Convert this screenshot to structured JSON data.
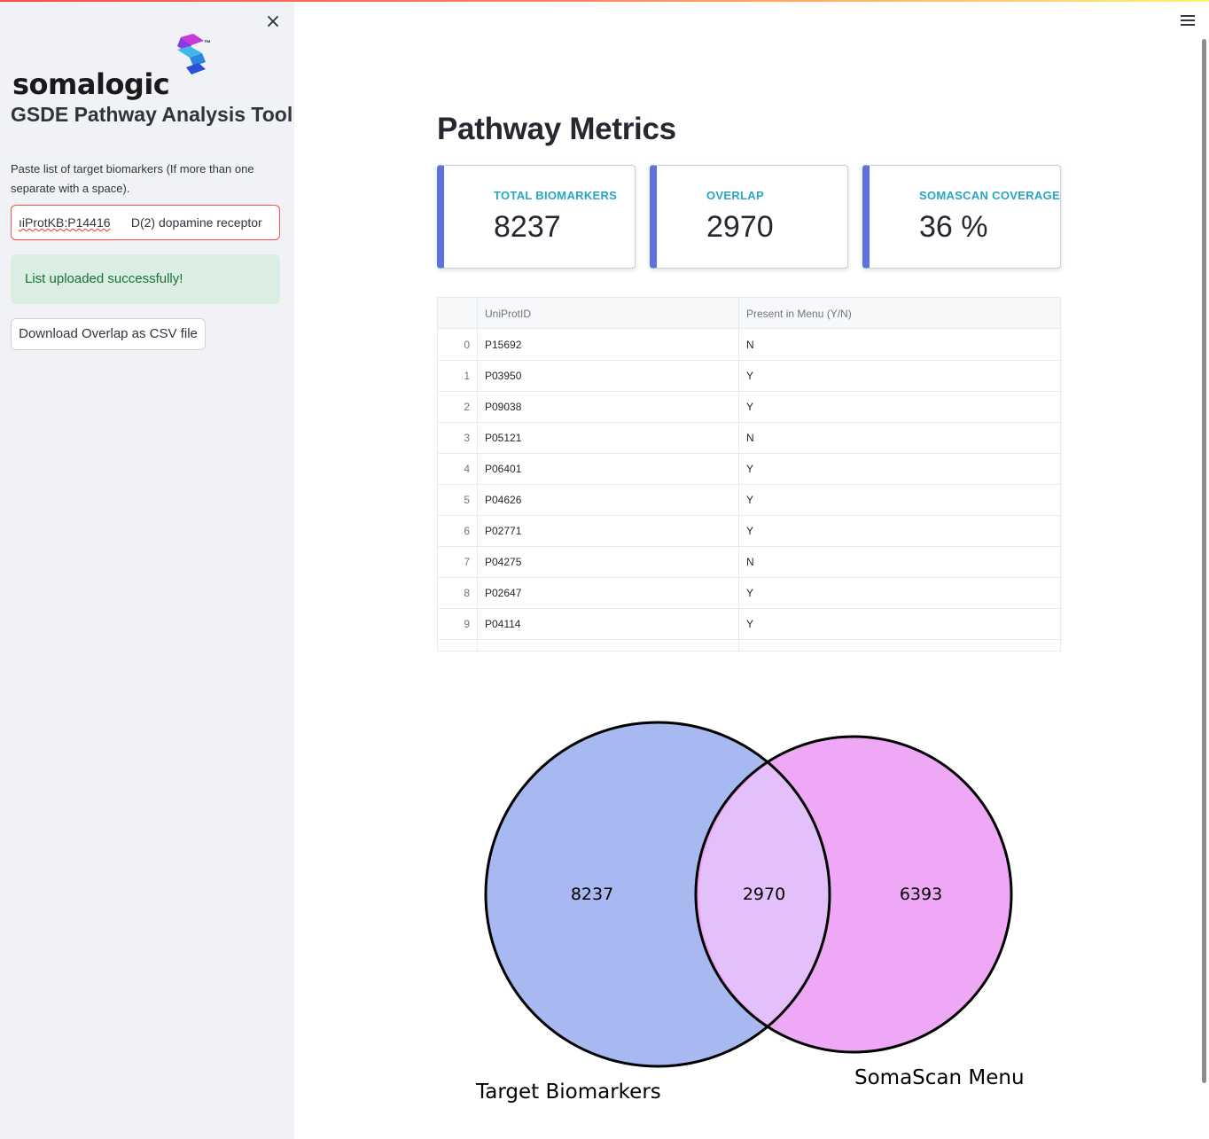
{
  "sidebar": {
    "close_label": "×",
    "logo_text": "somalogic",
    "logo_tm": "™",
    "app_title": "GSDE Pathway Analysis Tool",
    "paste_label": "Paste list of target biomarkers (If more than one separate with a space).",
    "input_value_prefix": "ıiProtKB:P14416",
    "input_value_suffix": "      D(2) dopamine receptor",
    "success_message": "List uploaded successfully!",
    "download_label": "Download Overlap as CSV file"
  },
  "main": {
    "title": "Pathway Metrics",
    "metrics": [
      {
        "label": "TOTAL BIOMARKERS",
        "value": "8237"
      },
      {
        "label": "OVERLAP",
        "value": "2970"
      },
      {
        "label": "SOMASCAN COVERAGE",
        "value": "36 %"
      }
    ],
    "table": {
      "headers": [
        "",
        "UniProtID",
        "Present in Menu (Y/N)"
      ],
      "rows": [
        [
          "0",
          "P15692",
          "N"
        ],
        [
          "1",
          "P03950",
          "Y"
        ],
        [
          "2",
          "P09038",
          "Y"
        ],
        [
          "3",
          "P05121",
          "N"
        ],
        [
          "4",
          "P06401",
          "Y"
        ],
        [
          "5",
          "P04626",
          "Y"
        ],
        [
          "6",
          "P02771",
          "Y"
        ],
        [
          "7",
          "P04275",
          "N"
        ],
        [
          "8",
          "P02647",
          "Y"
        ],
        [
          "9",
          "P04114",
          "Y"
        ]
      ]
    }
  },
  "chart_data": {
    "type": "venn",
    "sets": [
      {
        "name": "Target Biomarkers",
        "only_value": 8237,
        "color": "#a8b8f0"
      },
      {
        "name": "SomaScan Menu",
        "only_value": 6393,
        "color": "#eea8f5"
      }
    ],
    "overlap_value": 2970,
    "overlap_color": "#e4c0fa",
    "title": ""
  },
  "colors": {
    "accent": "#5a73e0",
    "metric_label": "#2aa4c4",
    "success_bg": "#dbeee3",
    "success_text": "#177233"
  }
}
